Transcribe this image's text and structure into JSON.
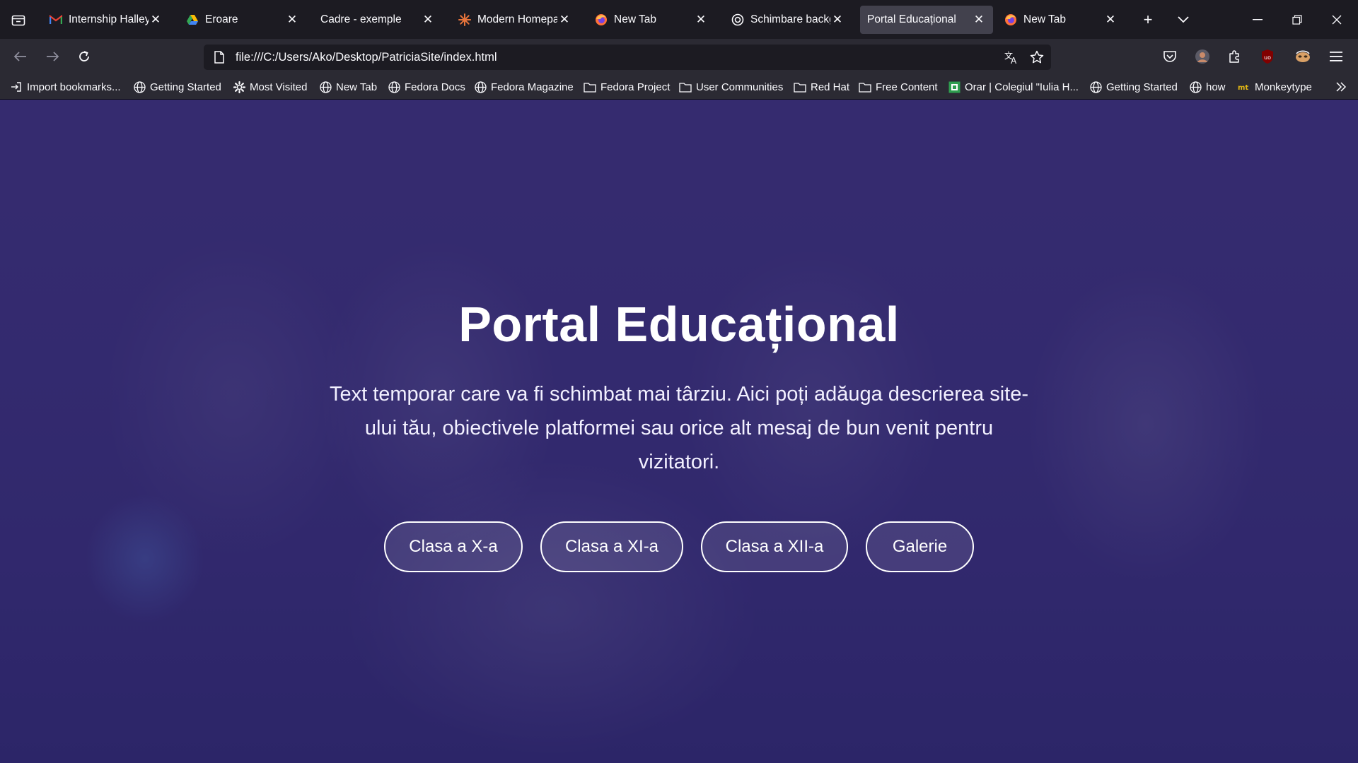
{
  "browser": {
    "tabs": [
      {
        "title": "Internship Halley K",
        "icon": "gmail-icon"
      },
      {
        "title": "Eroare",
        "icon": "google-drive-icon"
      },
      {
        "title": "Cadre - exemple",
        "icon": "none"
      },
      {
        "title": "Modern Homepag",
        "icon": "spark-icon"
      },
      {
        "title": "New Tab",
        "icon": "firefox-icon"
      },
      {
        "title": "Schimbare backgr",
        "icon": "openai-icon"
      },
      {
        "title": "Portal Educațional",
        "icon": "none",
        "active": true
      },
      {
        "title": "New Tab",
        "icon": "firefox-icon"
      }
    ],
    "url": "file:///C:/Users/Ako/Desktop/PatriciaSite/index.html",
    "bookmarks": [
      {
        "label": "Import bookmarks...",
        "icon": "import-icon"
      },
      {
        "label": "Getting Started",
        "icon": "globe-icon"
      },
      {
        "label": "Most Visited",
        "icon": "gear-icon"
      },
      {
        "label": "New Tab",
        "icon": "globe-icon"
      },
      {
        "label": "Fedora Docs",
        "icon": "globe-icon"
      },
      {
        "label": "Fedora Magazine",
        "icon": "globe-icon"
      },
      {
        "label": "Fedora Project",
        "icon": "folder-icon"
      },
      {
        "label": "User Communities",
        "icon": "folder-icon"
      },
      {
        "label": "Red Hat",
        "icon": "folder-icon"
      },
      {
        "label": "Free Content",
        "icon": "folder-icon"
      },
      {
        "label": "Orar | Colegiul \"Iulia H...",
        "icon": "green-site-icon"
      },
      {
        "label": "Getting Started",
        "icon": "globe-icon"
      },
      {
        "label": "how",
        "icon": "globe-icon"
      },
      {
        "label": "Monkeytype",
        "icon": "monkeytype-icon"
      }
    ]
  },
  "page": {
    "title": "Portal Educațional",
    "description": "Text temporar care va fi schimbat mai târziu. Aici poți adăuga descrierea site-ului tău, obiectivele platformei sau orice alt mesaj de bun venit pentru vizitatori.",
    "buttons": [
      {
        "label": "Clasa a X-a"
      },
      {
        "label": "Clasa a XI-a"
      },
      {
        "label": "Clasa a XII-a"
      },
      {
        "label": "Galerie"
      }
    ]
  },
  "colors": {
    "chrome_dark": "#1c1b22",
    "toolbar": "#2b2a33",
    "active_tab": "#42414d",
    "hero_overlay": "#3a3270"
  }
}
